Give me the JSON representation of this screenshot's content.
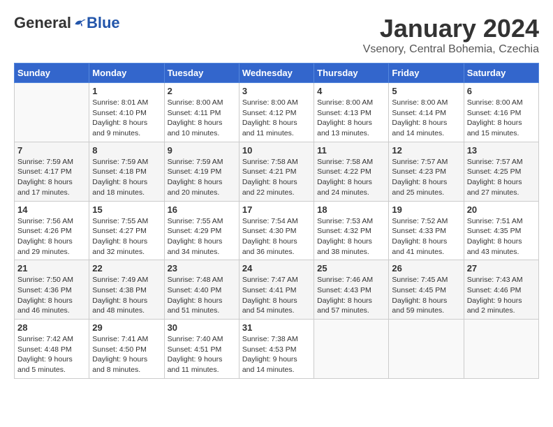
{
  "logo": {
    "general": "General",
    "blue": "Blue"
  },
  "title": "January 2024",
  "subtitle": "Vsenory, Central Bohemia, Czechia",
  "days_of_week": [
    "Sunday",
    "Monday",
    "Tuesday",
    "Wednesday",
    "Thursday",
    "Friday",
    "Saturday"
  ],
  "weeks": [
    [
      {
        "day": "",
        "info": ""
      },
      {
        "day": "1",
        "info": "Sunrise: 8:01 AM\nSunset: 4:10 PM\nDaylight: 8 hours\nand 9 minutes."
      },
      {
        "day": "2",
        "info": "Sunrise: 8:00 AM\nSunset: 4:11 PM\nDaylight: 8 hours\nand 10 minutes."
      },
      {
        "day": "3",
        "info": "Sunrise: 8:00 AM\nSunset: 4:12 PM\nDaylight: 8 hours\nand 11 minutes."
      },
      {
        "day": "4",
        "info": "Sunrise: 8:00 AM\nSunset: 4:13 PM\nDaylight: 8 hours\nand 13 minutes."
      },
      {
        "day": "5",
        "info": "Sunrise: 8:00 AM\nSunset: 4:14 PM\nDaylight: 8 hours\nand 14 minutes."
      },
      {
        "day": "6",
        "info": "Sunrise: 8:00 AM\nSunset: 4:16 PM\nDaylight: 8 hours\nand 15 minutes."
      }
    ],
    [
      {
        "day": "7",
        "info": "Sunrise: 7:59 AM\nSunset: 4:17 PM\nDaylight: 8 hours\nand 17 minutes."
      },
      {
        "day": "8",
        "info": "Sunrise: 7:59 AM\nSunset: 4:18 PM\nDaylight: 8 hours\nand 18 minutes."
      },
      {
        "day": "9",
        "info": "Sunrise: 7:59 AM\nSunset: 4:19 PM\nDaylight: 8 hours\nand 20 minutes."
      },
      {
        "day": "10",
        "info": "Sunrise: 7:58 AM\nSunset: 4:21 PM\nDaylight: 8 hours\nand 22 minutes."
      },
      {
        "day": "11",
        "info": "Sunrise: 7:58 AM\nSunset: 4:22 PM\nDaylight: 8 hours\nand 24 minutes."
      },
      {
        "day": "12",
        "info": "Sunrise: 7:57 AM\nSunset: 4:23 PM\nDaylight: 8 hours\nand 25 minutes."
      },
      {
        "day": "13",
        "info": "Sunrise: 7:57 AM\nSunset: 4:25 PM\nDaylight: 8 hours\nand 27 minutes."
      }
    ],
    [
      {
        "day": "14",
        "info": "Sunrise: 7:56 AM\nSunset: 4:26 PM\nDaylight: 8 hours\nand 29 minutes."
      },
      {
        "day": "15",
        "info": "Sunrise: 7:55 AM\nSunset: 4:27 PM\nDaylight: 8 hours\nand 32 minutes."
      },
      {
        "day": "16",
        "info": "Sunrise: 7:55 AM\nSunset: 4:29 PM\nDaylight: 8 hours\nand 34 minutes."
      },
      {
        "day": "17",
        "info": "Sunrise: 7:54 AM\nSunset: 4:30 PM\nDaylight: 8 hours\nand 36 minutes."
      },
      {
        "day": "18",
        "info": "Sunrise: 7:53 AM\nSunset: 4:32 PM\nDaylight: 8 hours\nand 38 minutes."
      },
      {
        "day": "19",
        "info": "Sunrise: 7:52 AM\nSunset: 4:33 PM\nDaylight: 8 hours\nand 41 minutes."
      },
      {
        "day": "20",
        "info": "Sunrise: 7:51 AM\nSunset: 4:35 PM\nDaylight: 8 hours\nand 43 minutes."
      }
    ],
    [
      {
        "day": "21",
        "info": "Sunrise: 7:50 AM\nSunset: 4:36 PM\nDaylight: 8 hours\nand 46 minutes."
      },
      {
        "day": "22",
        "info": "Sunrise: 7:49 AM\nSunset: 4:38 PM\nDaylight: 8 hours\nand 48 minutes."
      },
      {
        "day": "23",
        "info": "Sunrise: 7:48 AM\nSunset: 4:40 PM\nDaylight: 8 hours\nand 51 minutes."
      },
      {
        "day": "24",
        "info": "Sunrise: 7:47 AM\nSunset: 4:41 PM\nDaylight: 8 hours\nand 54 minutes."
      },
      {
        "day": "25",
        "info": "Sunrise: 7:46 AM\nSunset: 4:43 PM\nDaylight: 8 hours\nand 57 minutes."
      },
      {
        "day": "26",
        "info": "Sunrise: 7:45 AM\nSunset: 4:45 PM\nDaylight: 8 hours\nand 59 minutes."
      },
      {
        "day": "27",
        "info": "Sunrise: 7:43 AM\nSunset: 4:46 PM\nDaylight: 9 hours\nand 2 minutes."
      }
    ],
    [
      {
        "day": "28",
        "info": "Sunrise: 7:42 AM\nSunset: 4:48 PM\nDaylight: 9 hours\nand 5 minutes."
      },
      {
        "day": "29",
        "info": "Sunrise: 7:41 AM\nSunset: 4:50 PM\nDaylight: 9 hours\nand 8 minutes."
      },
      {
        "day": "30",
        "info": "Sunrise: 7:40 AM\nSunset: 4:51 PM\nDaylight: 9 hours\nand 11 minutes."
      },
      {
        "day": "31",
        "info": "Sunrise: 7:38 AM\nSunset: 4:53 PM\nDaylight: 9 hours\nand 14 minutes."
      },
      {
        "day": "",
        "info": ""
      },
      {
        "day": "",
        "info": ""
      },
      {
        "day": "",
        "info": ""
      }
    ]
  ]
}
